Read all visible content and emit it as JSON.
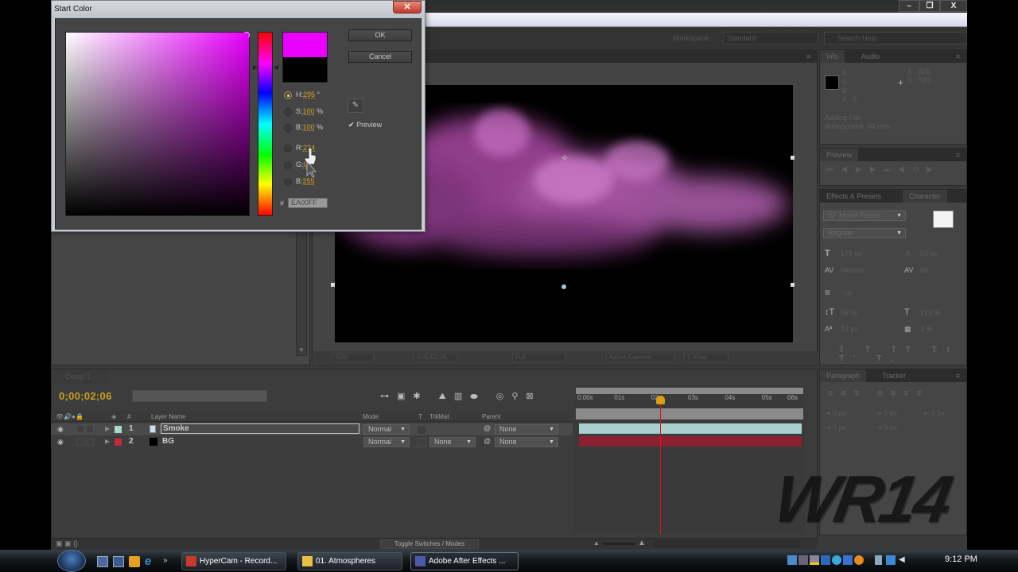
{
  "dialog": {
    "title": "Start Color",
    "ok_label": "OK",
    "cancel_label": "Cancel",
    "preview_label": "Preview",
    "preview_checked": true,
    "new_color": "#EA00FF",
    "old_color": "#000000",
    "fields": [
      {
        "key": "H",
        "label": "H:",
        "value": "295",
        "unit": "°",
        "selected": true
      },
      {
        "key": "S",
        "label": "S:",
        "value": "100",
        "unit": "%",
        "selected": false
      },
      {
        "key": "B",
        "label": "B:",
        "value": "100",
        "unit": "%",
        "selected": false
      },
      {
        "key": "R",
        "label": "R:",
        "value": "234",
        "unit": "",
        "selected": false
      },
      {
        "key": "G",
        "label": "G:",
        "value": "0",
        "unit": "",
        "selected": false
      },
      {
        "key": "Bl",
        "label": "B:",
        "value": "255",
        "unit": "",
        "selected": false
      }
    ],
    "hex_prefix": "#",
    "hex_value": "EA00FF"
  },
  "app": {
    "workspace_label": "Workspace:",
    "workspace_value": "Standard",
    "search_placeholder": "Search Help"
  },
  "info_panel": {
    "tabs": [
      "Info",
      "Audio"
    ],
    "rgba_labels": [
      "R :",
      "G :",
      "B :",
      "A : 0"
    ],
    "x": "X : 828",
    "y": "Y : 720",
    "message_line1": "Adding File:",
    "message_line2": "Atmosphere_04.mov"
  },
  "preview_panel": {
    "tab": "Preview"
  },
  "character_panel": {
    "tabs": [
      "Effects & Presets",
      "Character"
    ],
    "font": "SF Movie Poster",
    "style": "Regular",
    "size": "175 px",
    "leading": "53 px",
    "kerning": "Metrics",
    "tracking": "68",
    "stroke": "- px",
    "vscale": "58 %",
    "hscale": "123 %",
    "baseline": "12 px",
    "tsume": "1 %"
  },
  "paragraph_panel": {
    "tabs": [
      "Paragraph",
      "Tracker"
    ],
    "indents": [
      "0 px",
      "0 px",
      "0 px",
      "0 px",
      "0 px"
    ]
  },
  "viewer": {
    "zoom": "50%",
    "timecode": "0;00;02;06",
    "resolution": "Full",
    "camera": "Active Camera",
    "views": "1 View"
  },
  "timeline": {
    "tab": "Comp 1",
    "current_time": "0;00;02;06",
    "columns": {
      "layer_name": "Layer Name",
      "num": "#",
      "mode": "Mode",
      "t": "T",
      "trkmat": "TrkMat",
      "parent": "Parent"
    },
    "layers": [
      {
        "num": "1",
        "name": "Smoke",
        "label_color": "#a9d8cc",
        "mode": "Normal",
        "trkmat": "",
        "parent": "None",
        "selected": true,
        "bar_color": "#a9cfcf"
      },
      {
        "num": "2",
        "name": "BG",
        "label_color": "#c8283c",
        "mode": "Normal",
        "trkmat": "None",
        "parent": "None",
        "selected": false,
        "bar_color": "#8a2030"
      }
    ],
    "ruler_ticks": [
      "0:00s",
      "01s",
      "02s",
      "03s",
      "04s",
      "05s",
      "06s"
    ],
    "playhead_seconds": 2.2,
    "toggle_label": "Toggle Switches / Modes"
  },
  "taskbar": {
    "tasks": [
      {
        "label": "HyperCam - Record...",
        "active": false
      },
      {
        "label": "01. Atmospheres",
        "active": false
      },
      {
        "label": "Adobe After Effects ...",
        "active": true
      }
    ],
    "clock": "9:12 PM"
  },
  "watermark": "WR14"
}
